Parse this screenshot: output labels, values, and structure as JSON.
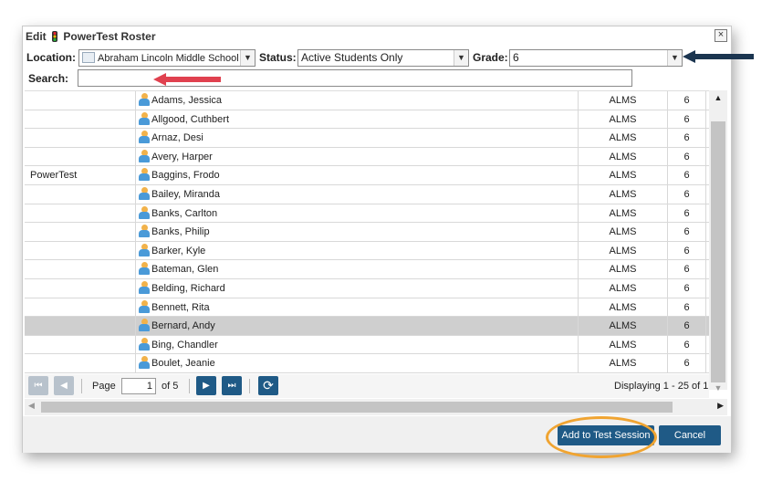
{
  "dialog": {
    "title_prefix": "Edit",
    "title_main": "PowerTest Roster",
    "close_glyph": "×"
  },
  "filters": {
    "location_label": "Location:",
    "location_value": "Abraham Lincoln Middle School [",
    "status_label": "Status:",
    "status_value": "Active Students Only",
    "grade_label": "Grade:",
    "grade_value": "6",
    "search_label": "Search:",
    "search_value": ""
  },
  "students": [
    {
      "group": "",
      "name": "Adams, Jessica",
      "school": "ALMS",
      "grade": "6",
      "selected": false
    },
    {
      "group": "",
      "name": "Allgood, Cuthbert",
      "school": "ALMS",
      "grade": "6",
      "selected": false
    },
    {
      "group": "",
      "name": "Arnaz, Desi",
      "school": "ALMS",
      "grade": "6",
      "selected": false
    },
    {
      "group": "",
      "name": "Avery, Harper",
      "school": "ALMS",
      "grade": "6",
      "selected": false
    },
    {
      "group": "PowerTest",
      "name": "Baggins, Frodo",
      "school": "ALMS",
      "grade": "6",
      "selected": false
    },
    {
      "group": "",
      "name": "Bailey, Miranda",
      "school": "ALMS",
      "grade": "6",
      "selected": false
    },
    {
      "group": "",
      "name": "Banks, Carlton",
      "school": "ALMS",
      "grade": "6",
      "selected": false
    },
    {
      "group": "",
      "name": "Banks, Philip",
      "school": "ALMS",
      "grade": "6",
      "selected": false
    },
    {
      "group": "",
      "name": "Barker, Kyle",
      "school": "ALMS",
      "grade": "6",
      "selected": false
    },
    {
      "group": "",
      "name": "Bateman, Glen",
      "school": "ALMS",
      "grade": "6",
      "selected": false
    },
    {
      "group": "",
      "name": "Belding, Richard",
      "school": "ALMS",
      "grade": "6",
      "selected": false
    },
    {
      "group": "",
      "name": "Bennett, Rita",
      "school": "ALMS",
      "grade": "6",
      "selected": false
    },
    {
      "group": "",
      "name": "Bernard, Andy",
      "school": "ALMS",
      "grade": "6",
      "selected": true
    },
    {
      "group": "",
      "name": "Bing, Chandler",
      "school": "ALMS",
      "grade": "6",
      "selected": false
    },
    {
      "group": "",
      "name": "Boulet, Jeanie",
      "school": "ALMS",
      "grade": "6",
      "selected": false
    }
  ],
  "pager": {
    "page_label": "Page",
    "page_value": "1",
    "of_label": "of 5",
    "display_text": "Displaying 1 - 25 of 1",
    "first_glyph": "⏮",
    "prev_glyph": "◀",
    "next_glyph": "▶",
    "last_glyph": "⏭",
    "refresh_glyph": "⟳"
  },
  "footer": {
    "add_label": "Add to Test Session",
    "cancel_label": "Cancel"
  },
  "icons": {
    "person": "person-icon",
    "traffic_light": "traffic-light-icon"
  },
  "colors": {
    "primary_button": "#1f5a86",
    "highlight_ring": "#f0a431",
    "red_arrow": "#e0414f",
    "navy_arrow": "#1b3550",
    "selected_row": "#cfcfcf"
  }
}
